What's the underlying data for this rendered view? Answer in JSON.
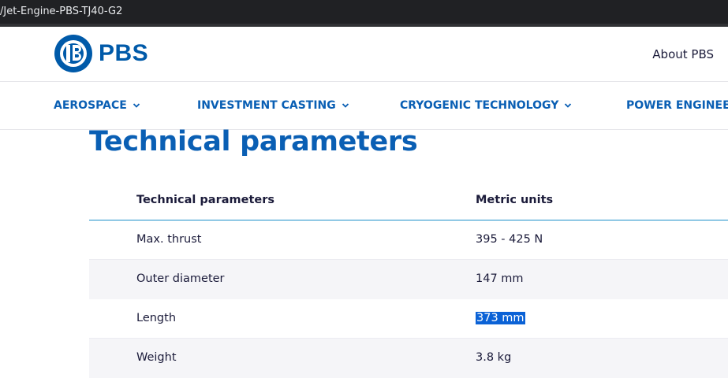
{
  "browser": {
    "url_text": "/Jet-Engine-PBS-TJ40-G2"
  },
  "header": {
    "logo_text": "PBS",
    "about_link": "About PBS"
  },
  "nav": {
    "items": [
      {
        "label": "AEROSPACE"
      },
      {
        "label": "INVESTMENT CASTING"
      },
      {
        "label": "CRYOGENIC TECHNOLOGY"
      },
      {
        "label": "POWER ENGINEERING"
      }
    ]
  },
  "main": {
    "title": "Technical parameters",
    "table": {
      "columns": [
        "Technical parameters",
        "Metric units"
      ],
      "rows": [
        {
          "param": "Max. thrust",
          "value": "395 - 425 N"
        },
        {
          "param": "Outer diameter",
          "value": "147 mm"
        },
        {
          "param": "Length",
          "value": "373 mm",
          "selected": true
        },
        {
          "param": "Weight",
          "value": "3.8 kg"
        }
      ]
    }
  },
  "colors": {
    "brand_blue": "#005aa9",
    "nav_blue": "#0a5fb4",
    "header_rule": "#1a8fc9",
    "selection": "#0b62d6"
  }
}
